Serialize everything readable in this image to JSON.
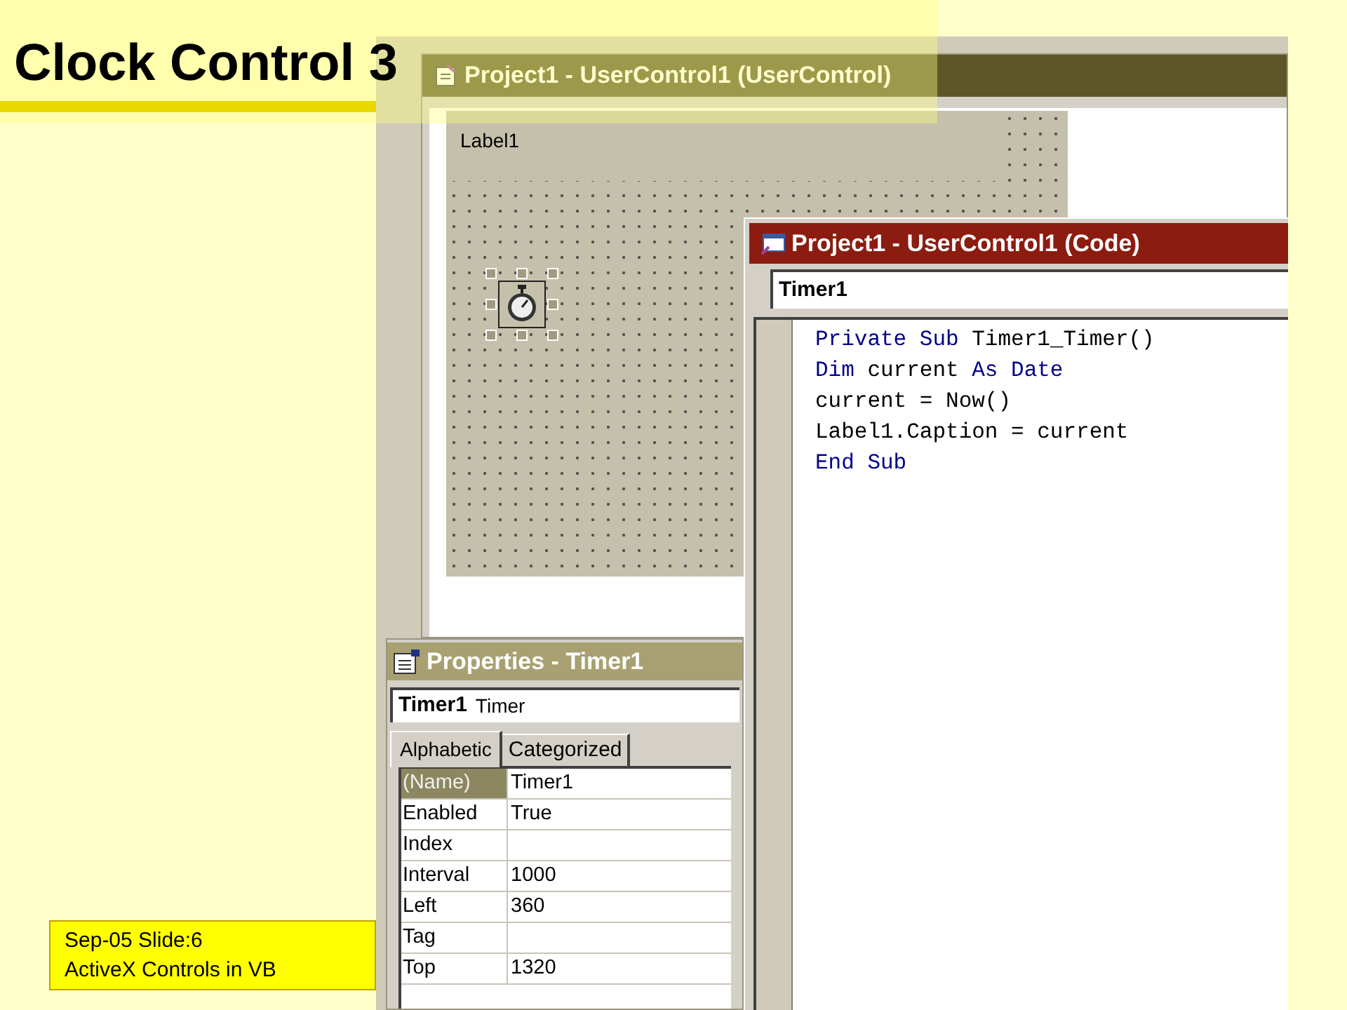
{
  "slide": {
    "title": "Clock Control 3",
    "footer": [
      "Sep-05 Slide:6",
      "ActiveX Controls in VB"
    ]
  },
  "designer_window": {
    "title": "Project1 - UserControl1 (UserControl)",
    "label": "Label1"
  },
  "code_window": {
    "title": "Project1 - UserControl1 (Code)",
    "object_box": "Timer1",
    "lines": [
      [
        {
          "text": "Private Sub",
          "kind": "keyword"
        },
        {
          "text": " Timer1_Timer()",
          "kind": "plain"
        }
      ],
      [
        {
          "text": "Dim",
          "kind": "keyword"
        },
        {
          "text": " current ",
          "kind": "plain"
        },
        {
          "text": "As Date",
          "kind": "keyword"
        }
      ],
      [
        {
          "text": "current = Now()",
          "kind": "plain"
        }
      ],
      [
        {
          "text": "Label1.Caption = current",
          "kind": "plain"
        }
      ],
      [
        {
          "text": "End Sub",
          "kind": "keyword"
        }
      ]
    ]
  },
  "properties_window": {
    "title": "Properties - Timer1",
    "object_name": "Timer1",
    "object_type": "Timer",
    "tabs": [
      {
        "label": "Alphabetic",
        "selected": true
      },
      {
        "label": "Categorized",
        "selected": false
      }
    ],
    "rows": [
      {
        "name": "(Name)",
        "value": "Timer1",
        "selected": true
      },
      {
        "name": "Enabled",
        "value": "True",
        "selected": false
      },
      {
        "name": "Index",
        "selected": false
      },
      {
        "name": "Interval",
        "value": "1000",
        "selected": false
      },
      {
        "name": "Left",
        "value": "360",
        "selected": false
      },
      {
        "name": "Tag",
        "selected": false
      },
      {
        "name": "Top",
        "value": "1320",
        "selected": false
      }
    ]
  }
}
